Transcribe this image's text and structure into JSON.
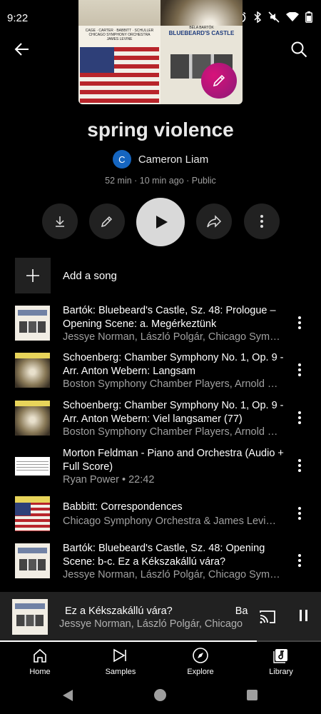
{
  "status_bar": {
    "time": "9:22"
  },
  "collage": {
    "top_left_caption": "CAGE · CARTER · BABBITT · SCHULLER\nCHICAGO SYMPHONY ORCHESTRA\nJAMES LEVINE",
    "bottom_right_title": "BLUEBEARD'S CASTLE",
    "bottom_right_composer": "BÉLA BARTÓK"
  },
  "playlist": {
    "title": "spring violence",
    "owner_initial": "C",
    "owner_name": "Cameron Liam",
    "meta": "52 min · 10 min ago · Public"
  },
  "actions": {
    "add_song_label": "Add a song"
  },
  "songs": [
    {
      "title": "Bartók: Bluebeard's Castle, Sz. 48: Prologue – Opening Scene: a. Megérkeztünk",
      "subtitle": "Jessye Norman, László Polgár, Chicago Sym…",
      "art": "bluebeard"
    },
    {
      "title": "Schoenberg: Chamber Symphony No. 1, Op. 9 - Arr. Anton Webern: Langsam",
      "subtitle": "Boston Symphony Chamber Players, Arnold …",
      "art": "schoenberg"
    },
    {
      "title": "Schoenberg: Chamber Symphony No. 1, Op. 9 - Arr. Anton Webern: Viel langsamer (77)",
      "subtitle": "Boston Symphony Chamber Players, Arnold …",
      "art": "schoenberg"
    },
    {
      "title": "Morton Feldman - Piano and Orchestra (Audio + Full Score)",
      "subtitle": "Ryan Power • 22:42",
      "art": "score"
    },
    {
      "title": "Babbitt: Correspondences",
      "subtitle": "Chicago Symphony Orchestra & James Levi…",
      "art": "flag"
    },
    {
      "title": "Bartók: Bluebeard's Castle, Sz. 48: Opening Scene: b-c. Ez a Kékszakállú vára?",
      "subtitle": "Jessye Norman, László Polgár, Chicago Sym…",
      "art": "bluebeard"
    }
  ],
  "now_playing": {
    "title": "Ez a Kékszakállú vára?",
    "title_next": "Bar",
    "subtitle": "Jessye Norman, László Polgár, Chicago",
    "progress": 0.8
  },
  "bottom_nav": [
    {
      "label": "Home",
      "icon": "home-icon"
    },
    {
      "label": "Samples",
      "icon": "samples-icon"
    },
    {
      "label": "Explore",
      "icon": "compass-icon"
    },
    {
      "label": "Library",
      "icon": "library-icon"
    }
  ],
  "colors": {
    "background": "#000000",
    "button_bg": "#212121",
    "play_button": "#d9d9d9",
    "edit_fab": "#c2187a",
    "avatar": "#1565c0",
    "secondary_text": "#a0a0a0"
  }
}
